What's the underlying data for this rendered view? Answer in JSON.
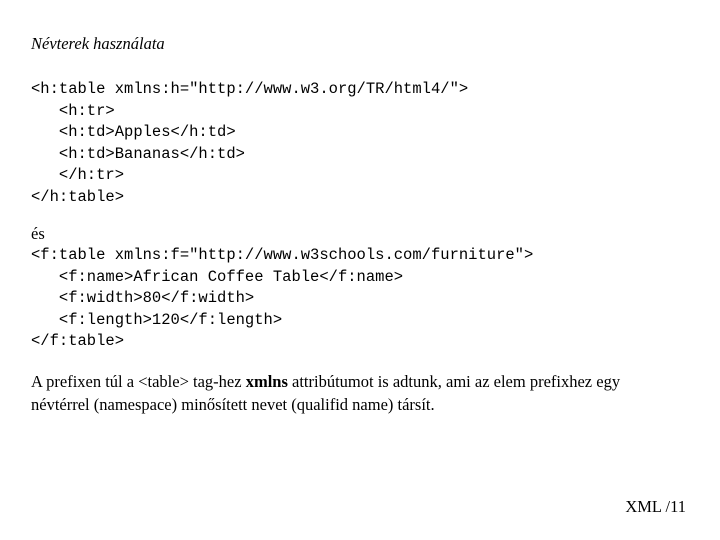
{
  "slide": {
    "title": "Névterek használata",
    "code_block_1": "<h:table xmlns:h=\"http://www.w3.org/TR/html4/\">\n   <h:tr>\n   <h:td>Apples</h:td>\n   <h:td>Bananas</h:td>\n   </h:tr>\n</h:table>",
    "connector": "és",
    "code_block_2": "<f:table xmlns:f=\"http://www.w3schools.com/furniture\">\n   <f:name>African Coffee Table</f:name>\n   <f:width>80</f:width>\n   <f:length>120</f:length>\n</f:table>",
    "paragraph": {
      "part1": "A prefixen túl a <table> tag-hez ",
      "emphasis": "xmlns",
      "part2": " attribútumot is adtunk, ami az elem prefixhez egy névtérrel (namespace) minősített nevet (qualifid name) társít."
    },
    "footer": "XML /11"
  }
}
